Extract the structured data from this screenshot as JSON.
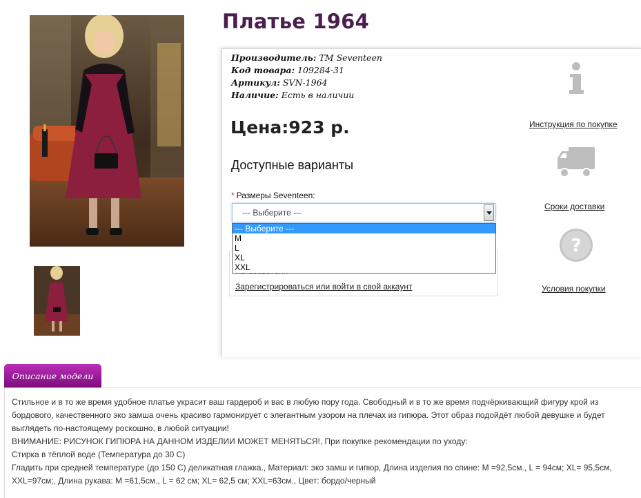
{
  "product": {
    "title": "Платье 1964",
    "price": "Цена:923 р."
  },
  "specs": [
    {
      "key": "Производитель:",
      "value": "ТМ Seventeen"
    },
    {
      "key": "Код товара:",
      "value": "109284-31"
    },
    {
      "key": "Артикул:",
      "value": "SVN-1964"
    },
    {
      "key": "Наличие:",
      "value": "Есть в наличии"
    }
  ],
  "variants": {
    "heading": "Доступные варианты",
    "size_label": "Размеры Seventeen:",
    "required_mark": "*",
    "selected": "--- Выберите ---",
    "options": [
      "--- Выберите ---",
      "M",
      "L",
      "XL",
      "XXL"
    ]
  },
  "login": {
    "hint": "пользователи",
    "link": "Зарегистрироваться или войти в свой аккаунт"
  },
  "sidebar": {
    "instructions": "Инструкция по покупке",
    "delivery": "Сроки доставки",
    "terms": "Условия покупки"
  },
  "description": {
    "tab": "Описание модели",
    "line1": "Стильное и в то же время удобное платье украсит ваш гардероб и вас в любую пору года. Свободный и в то же время подчёркивающий фигуру крой из бордового, качественного эко замша очень красиво гармонирует с элегантным узором на плечах из гипюра. Этот образ подойдёт любой девушке и будет выглядеть по-настоящему роскошно, в любой ситуации!",
    "line2": "ВНИМАНИЕ: РИСУНОК ГИПЮРА НА ДАННОМ ИЗДЕЛИИ МОЖЕТ МЕНЯТЬСЯ!, При покупке рекомендации по уходу:",
    "line3": "Стирка в тёплой воде (Температура до 30 С)",
    "line4": "Гладить при средней температуре (до 150 С) деликатная глажка., Материал: эко замш и гипюр, Длина изделия по спине: M =92,5см., L = 94см; XL= 95,5см, XXL=97см;, Длина рукава: M =61,5см., L = 62 см; XL= 62,5 см; XXL=63см., Цвет: бордо/черный"
  },
  "colors": {
    "title": "#4a1f4f",
    "tab_top": "#b92fb6",
    "tab_bottom": "#7d0d7d",
    "dress": "#8c1f3e",
    "option_selected": "#3399ff"
  }
}
